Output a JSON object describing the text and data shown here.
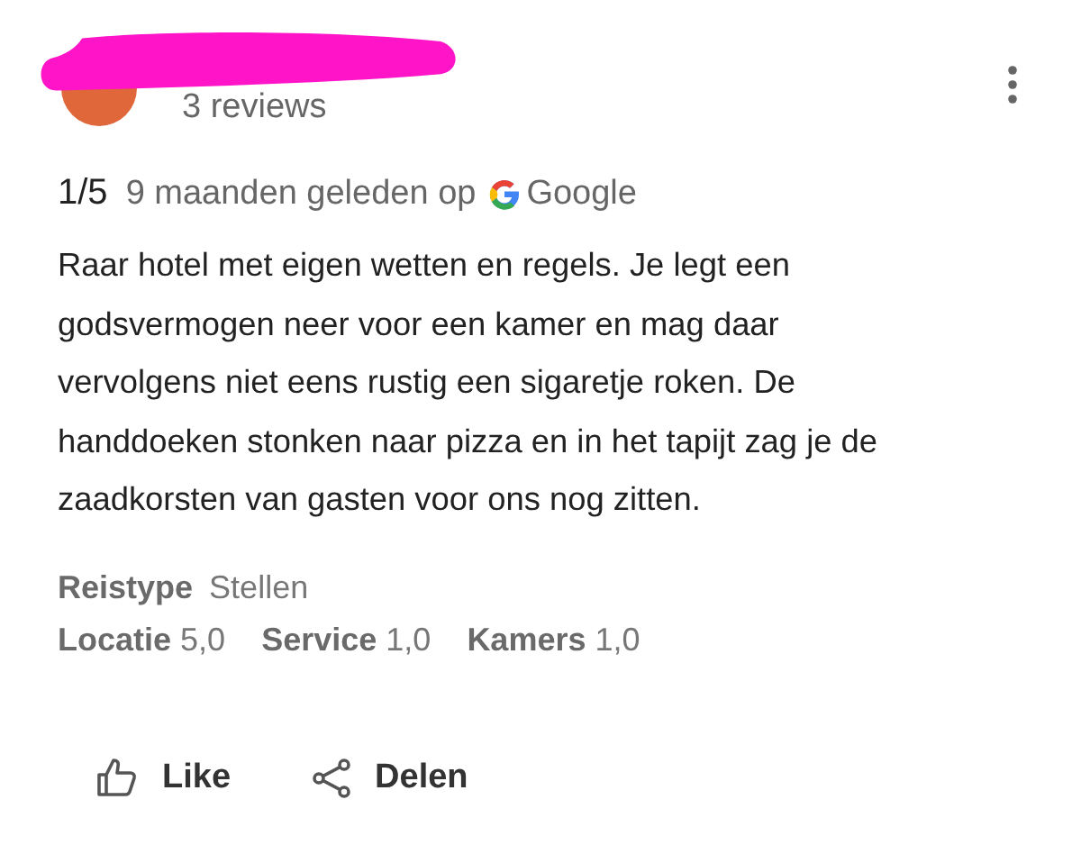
{
  "reviewer": {
    "reviews_count": "3 reviews",
    "name_redacted": true
  },
  "rating": "1/5",
  "posted": "9 maanden geleden op",
  "source": "Google",
  "review_text": "Raar hotel met eigen wetten en regels. Je legt een godsvermogen neer voor een kamer en mag daar vervolgens niet eens rustig een sigaretje roken. De handdoeken stonken naar pizza en in het tapijt zag je de zaadkorsten van gasten voor ons nog zitten.",
  "trip_type": {
    "label": "Reistype",
    "value": "Stellen"
  },
  "scores": [
    {
      "label": "Locatie",
      "value": "5,0"
    },
    {
      "label": "Service",
      "value": "1,0"
    },
    {
      "label": "Kamers",
      "value": "1,0"
    }
  ],
  "actions": [
    {
      "kind": "like",
      "label": "Like"
    },
    {
      "kind": "share",
      "label": "Delen"
    }
  ]
}
